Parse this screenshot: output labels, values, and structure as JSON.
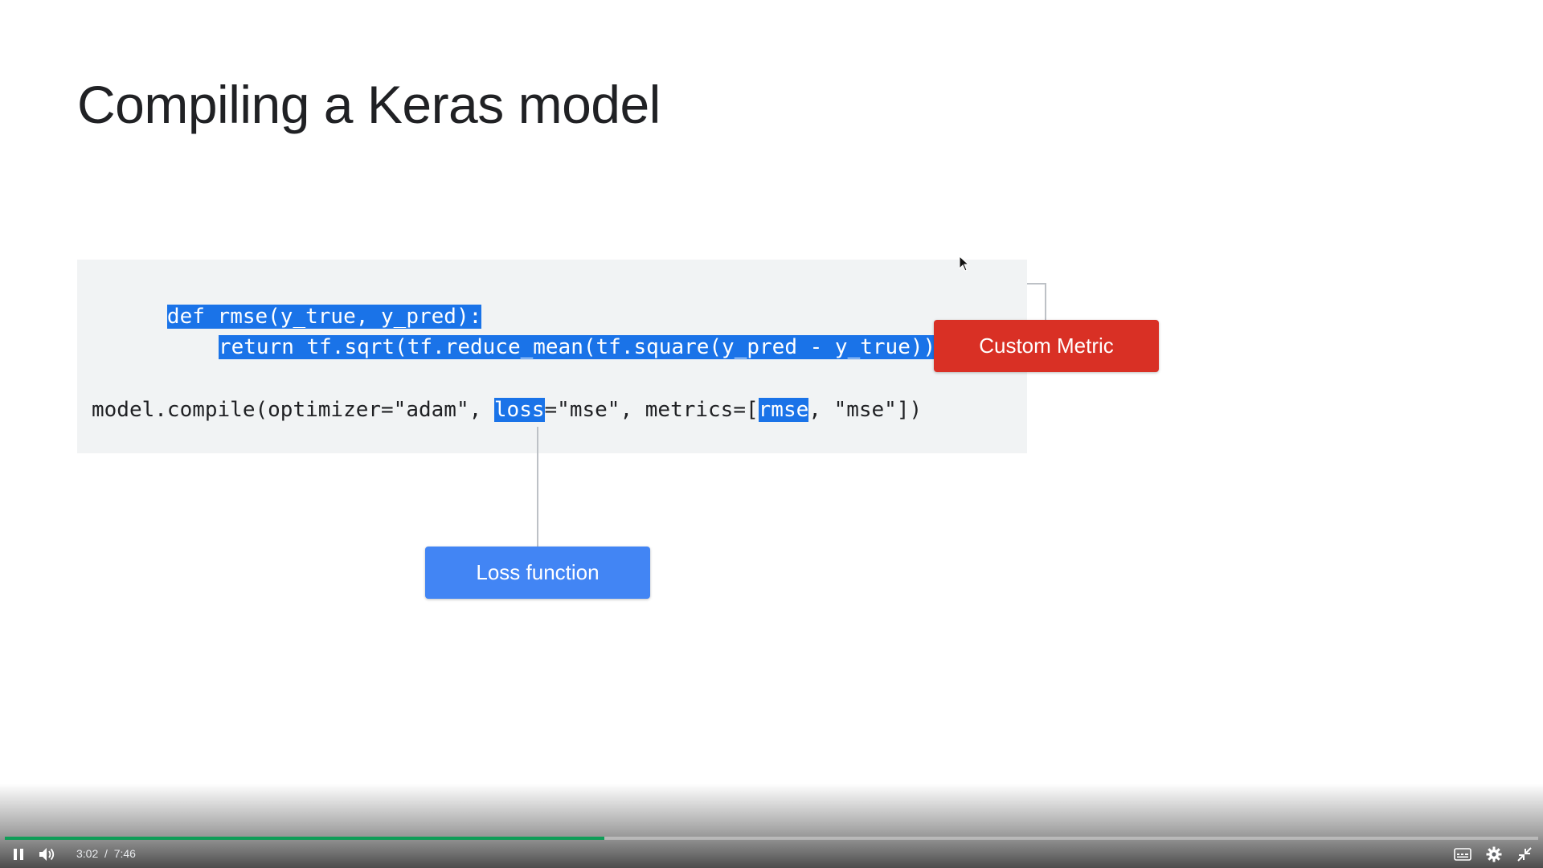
{
  "slide": {
    "title": "Compiling a Keras model"
  },
  "code": {
    "line1": "def rmse(y_true, y_pred):",
    "line2": "return tf.sqrt(tf.reduce_mean(tf.square(y_pred - y_true)))",
    "line3_prefix": "model.compile(optimizer=\"adam\", ",
    "line3_loss": "loss",
    "line3_middle": "=\"mse\", metrics=[",
    "line3_rmse": "rmse",
    "line3_suffix": ", \"mse\"])"
  },
  "callouts": {
    "custom_metric": "Custom Metric",
    "loss_function": "Loss function"
  },
  "colors": {
    "highlight": "#1a73e8",
    "custom_metric": "#d93025",
    "loss_function": "#4285f4",
    "progress": "#0f9d58"
  },
  "player": {
    "current_time": "3:02",
    "separator": "/",
    "duration": "7:46",
    "progress_fraction": 0.391,
    "icons": {
      "play_pause": "pause-icon",
      "volume": "volume-icon",
      "captions": "captions-icon",
      "settings": "gear-icon",
      "fullscreen": "exit-fullscreen-icon"
    }
  }
}
